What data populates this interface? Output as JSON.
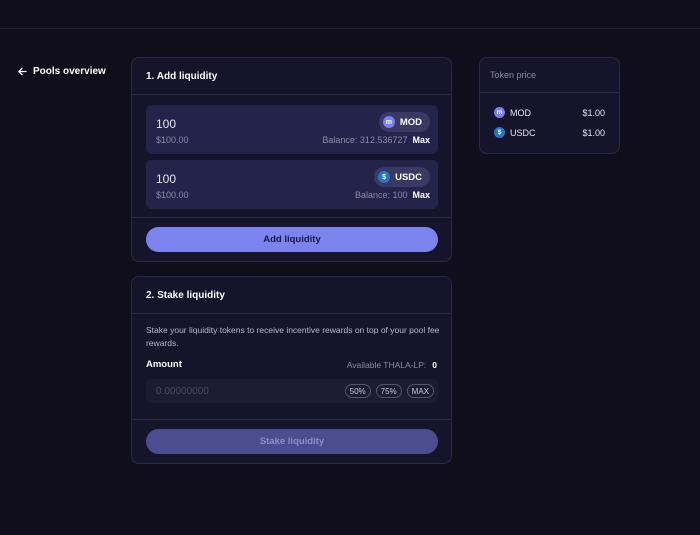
{
  "nav": {
    "back_label": "Pools overview"
  },
  "add_liquidity": {
    "title": "1. Add liquidity",
    "tokens": [
      {
        "amount": "100",
        "usd": "$100.00",
        "symbol": "MOD",
        "balance": "Balance: 312.536727",
        "max_label": "Max",
        "icon": "mod-token-icon"
      },
      {
        "amount": "100",
        "usd": "$100.00",
        "symbol": "USDC",
        "balance": "Balance: 100",
        "max_label": "Max",
        "icon": "usdc-token-icon"
      }
    ],
    "button_label": "Add liquidity"
  },
  "stake_liquidity": {
    "title": "2. Stake liquidity",
    "description": "Stake your liquidity tokens to receive incentive rewards on top of your pool fee rewards.",
    "amount_label": "Amount",
    "available_label": "Available THALA-LP:",
    "available_value": "0",
    "input_placeholder": "0.00000000",
    "pct_buttons": [
      "50%",
      "75%",
      "MAX"
    ],
    "button_label": "Stake liquidity"
  },
  "token_price": {
    "title": "Token price",
    "rows": [
      {
        "symbol": "MOD",
        "price": "$1.00",
        "icon": "mod-token-icon"
      },
      {
        "symbol": "USDC",
        "price": "$1.00",
        "icon": "usdc-token-icon"
      }
    ]
  },
  "colors": {
    "background": "#0f0e1a",
    "card": "#15142a",
    "accent": "#7b84ee",
    "accent_disabled": "#4a4d8e"
  }
}
